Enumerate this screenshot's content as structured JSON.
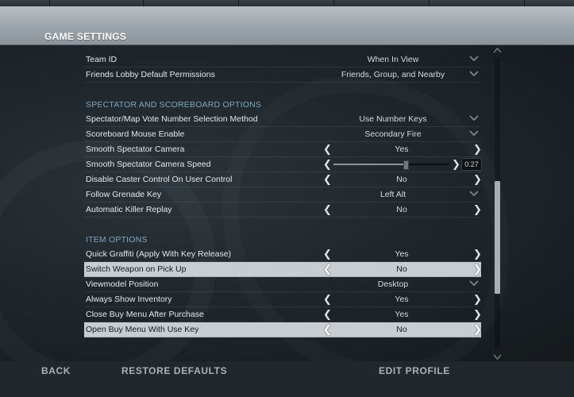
{
  "header": {
    "title": "GAME SETTINGS"
  },
  "rows_top": [
    {
      "label": "Team ID",
      "type": "dropdown",
      "value": "When In View"
    },
    {
      "label": "Friends Lobby Default Permissions",
      "type": "dropdown",
      "value": "Friends, Group, and Nearby"
    }
  ],
  "sections": {
    "spectator": "SPECTATOR AND SCOREBOARD OPTIONS",
    "item": "ITEM OPTIONS"
  },
  "spectator_rows": [
    {
      "label": "Spectator/Map Vote Number Selection Method",
      "type": "dropdown",
      "value": "Use Number Keys"
    },
    {
      "label": "Scoreboard Mouse Enable",
      "type": "dropdown",
      "value": "Secondary Fire"
    },
    {
      "label": "Smooth Spectator Camera",
      "type": "toggle",
      "value": "Yes"
    },
    {
      "label": "Smooth Spectator Camera Speed",
      "type": "slider",
      "value": "0.27",
      "fraction": 0.62
    },
    {
      "label": "Disable Caster Control On User Control",
      "type": "toggle",
      "value": "No"
    },
    {
      "label": "Follow Grenade Key",
      "type": "dropdown",
      "value": "Left Alt"
    },
    {
      "label": "Automatic Killer Replay",
      "type": "toggle",
      "value": "No"
    }
  ],
  "item_rows": [
    {
      "label": "Quick Graffiti (Apply With Key Release)",
      "type": "toggle",
      "value": "Yes"
    },
    {
      "label": "Switch Weapon on Pick Up",
      "type": "toggle",
      "value": "No",
      "highlighted": true
    },
    {
      "label": "Viewmodel Position",
      "type": "dropdown",
      "value": "Desktop"
    },
    {
      "label": "Always Show Inventory",
      "type": "toggle",
      "value": "Yes"
    },
    {
      "label": "Close Buy Menu After Purchase",
      "type": "toggle",
      "value": "Yes"
    },
    {
      "label": "Open Buy Menu With Use Key",
      "type": "toggle",
      "value": "No",
      "highlighted": true
    }
  ],
  "footer": {
    "back": "BACK",
    "restore": "RESTORE DEFAULTS",
    "edit_profile": "EDIT PROFILE"
  },
  "scrollbar": {
    "position": 0.45
  },
  "colors": {
    "header": "#a7afb4",
    "section": "#7ea7c2",
    "highlight_row": "#c7cdd1"
  }
}
